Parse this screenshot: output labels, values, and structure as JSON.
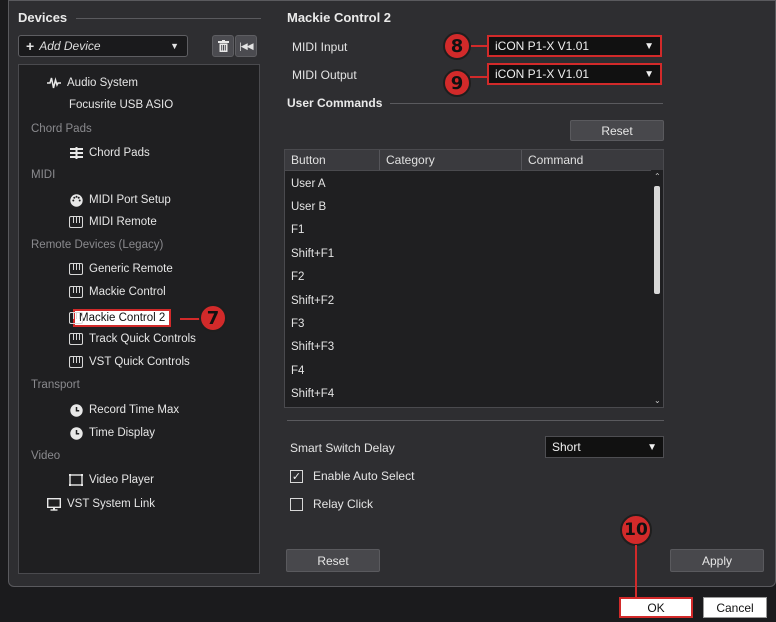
{
  "devices": {
    "title": "Devices",
    "add_device_label": "Add Device",
    "tree": {
      "audio_system": "Audio System",
      "focusrite": "Focusrite USB ASIO",
      "cat_chord_pads": "Chord Pads",
      "chord_pads": "Chord Pads",
      "cat_midi": "MIDI",
      "midi_port_setup": "MIDI Port Setup",
      "midi_remote": "MIDI Remote",
      "cat_remote": "Remote Devices (Legacy)",
      "generic_remote": "Generic Remote",
      "mackie_control": "Mackie Control",
      "mackie_control_2": "Mackie Control 2",
      "track_quick_controls": "Track Quick Controls",
      "vst_quick_controls": "VST Quick Controls",
      "cat_transport": "Transport",
      "record_time_max": "Record Time Max",
      "time_display": "Time Display",
      "cat_video": "Video",
      "video_player": "Video Player",
      "vst_system_link": "VST System Link"
    }
  },
  "panel": {
    "title": "Mackie Control 2",
    "midi_input_label": "MIDI Input",
    "midi_input_value": "iCON P1-X V1.01",
    "midi_output_label": "MIDI Output",
    "midi_output_value": "iCON P1-X V1.01",
    "user_commands_title": "User Commands",
    "reset_label": "Reset",
    "columns": [
      "Button",
      "Category",
      "Command"
    ],
    "rows": [
      "User A",
      "User B",
      "F1",
      "Shift+F1",
      "F2",
      "Shift+F2",
      "F3",
      "Shift+F3",
      "F4",
      "Shift+F4"
    ],
    "smart_switch_label": "Smart Switch Delay",
    "smart_switch_value": "Short",
    "enable_auto_select": "Enable Auto Select",
    "relay_click": "Relay Click",
    "bottom_reset": "Reset",
    "apply": "Apply"
  },
  "footer": {
    "ok": "OK",
    "cancel": "Cancel"
  },
  "callouts": [
    "7",
    "8",
    "9",
    "10"
  ],
  "colors": {
    "callout_red": "#d22a2a",
    "background": "#2e2e31"
  }
}
